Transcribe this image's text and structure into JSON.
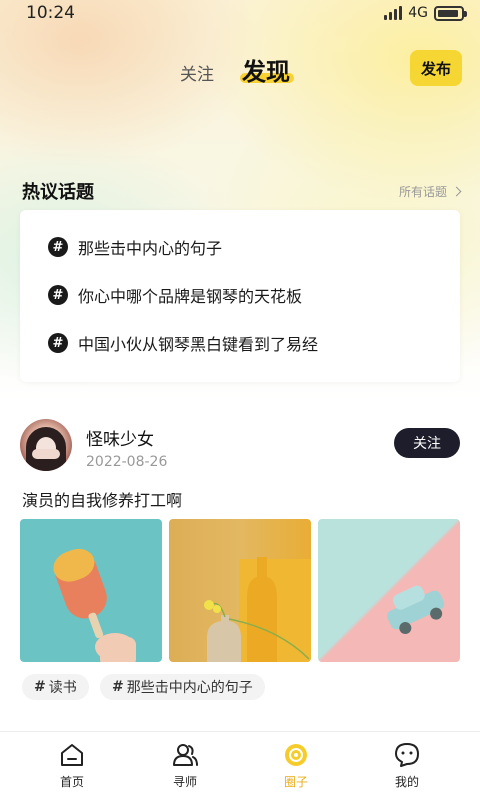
{
  "status_bar": {
    "time": "10:24",
    "network": "4G",
    "battery_level": 0.9
  },
  "header": {
    "tabs": [
      {
        "label": "关注"
      },
      {
        "label": "发现"
      }
    ],
    "active_tab": "发现",
    "publish_label": "发布"
  },
  "hot_topics": {
    "title": "热议话题",
    "all_link": "所有话题",
    "items": [
      {
        "label": "那些击中内心的句子"
      },
      {
        "label": "你心中哪个品牌是钢琴的天花板"
      },
      {
        "label": "中国小伙从钢琴黑白键看到了易经"
      }
    ]
  },
  "post": {
    "username": "怪味少女",
    "date": "2022-08-26",
    "follow_label": "关注",
    "text": "演员的自我修养打工啊",
    "images": [
      {
        "icon": "popsicle-photo"
      },
      {
        "icon": "vase-photo"
      },
      {
        "icon": "toy-car-photo"
      }
    ],
    "tags": [
      {
        "hash": "#",
        "label": "读书"
      },
      {
        "hash": "#",
        "label": "那些击中内心的句子"
      }
    ]
  },
  "bottom_nav": {
    "items": [
      {
        "label": "首页",
        "icon": "home-icon"
      },
      {
        "label": "寻师",
        "icon": "users-icon"
      },
      {
        "label": "圈子",
        "icon": "circle-icon"
      },
      {
        "label": "我的",
        "icon": "chat-face-icon"
      }
    ],
    "active": "圈子"
  },
  "colors": {
    "accent": "#f6d633",
    "active_nav": "#e8ad1c",
    "dark_button": "#1d1d2b"
  }
}
